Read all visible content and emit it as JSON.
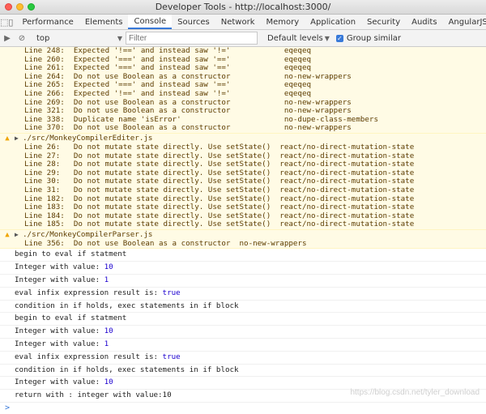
{
  "window": {
    "title": "Developer Tools - http://localhost:3000/"
  },
  "tabs": [
    "Performance",
    "Elements",
    "Console",
    "Sources",
    "Network",
    "Memory",
    "Application",
    "Security",
    "Audits",
    "AngularJS"
  ],
  "active_tab": "Console",
  "toolbar": {
    "context": "top",
    "filter_placeholder": "Filter",
    "levels": "Default levels",
    "group_similar": "Group similar"
  },
  "warnings_block1": [
    "Line 248:  Expected '!==' and instead saw '!='            eqeqeq",
    "Line 260:  Expected '===' and instead saw '=='            eqeqeq",
    "Line 261:  Expected '===' and instead saw '=='            eqeqeq",
    "Line 264:  Do not use Boolean as a constructor            no-new-wrappers",
    "Line 265:  Expected '===' and instead saw '=='            eqeqeq",
    "Line 266:  Expected '!==' and instead saw '!='            eqeqeq",
    "Line 269:  Do not use Boolean as a constructor            no-new-wrappers",
    "Line 321:  Do not use Boolean as a constructor            no-new-wrappers",
    "Line 338:  Duplicate name 'isError'                       no-dupe-class-members",
    "Line 370:  Do not use Boolean as a constructor            no-new-wrappers"
  ],
  "group2": {
    "header": "./src/MonkeyCompilerEditer.js",
    "lines": [
      "Line 26:   Do not mutate state directly. Use setState()  react/no-direct-mutation-state",
      "Line 27:   Do not mutate state directly. Use setState()  react/no-direct-mutation-state",
      "Line 28:   Do not mutate state directly. Use setState()  react/no-direct-mutation-state",
      "Line 29:   Do not mutate state directly. Use setState()  react/no-direct-mutation-state",
      "Line 30:   Do not mutate state directly. Use setState()  react/no-direct-mutation-state",
      "Line 31:   Do not mutate state directly. Use setState()  react/no-direct-mutation-state",
      "Line 182:  Do not mutate state directly. Use setState()  react/no-direct-mutation-state",
      "Line 183:  Do not mutate state directly. Use setState()  react/no-direct-mutation-state",
      "Line 184:  Do not mutate state directly. Use setState()  react/no-direct-mutation-state",
      "Line 185:  Do not mutate state directly. Use setState()  react/no-direct-mutation-state"
    ]
  },
  "group3": {
    "header": "./src/MonkeyCompilerParser.js",
    "lines": [
      "Line 356:  Do not use Boolean as a constructor  no-new-wrappers"
    ]
  },
  "logs": [
    {
      "text": "begin to eval if statment",
      "value": ""
    },
    {
      "text": "Integer with value: ",
      "value": "10"
    },
    {
      "text": "Integer with value: ",
      "value": "1"
    },
    {
      "text": "eval infix expression result is: ",
      "value": "true"
    },
    {
      "text": "condition in if holds, exec statements in if block",
      "value": ""
    },
    {
      "text": "begin to eval if statment",
      "value": ""
    },
    {
      "text": "Integer with value: ",
      "value": "10"
    },
    {
      "text": "Integer with value: ",
      "value": "1"
    },
    {
      "text": "eval infix expression result is: ",
      "value": "true"
    },
    {
      "text": "condition in if holds, exec statements in if block",
      "value": ""
    },
    {
      "text": "Integer with value: ",
      "value": "10"
    },
    {
      "text": "return with : integer with value:10",
      "value": ""
    }
  ],
  "prompt_symbol": ">",
  "watermark": "https://blog.csdn.net/tyler_download",
  "colors": {
    "accent": "#3879d9",
    "warning_bg": "#fffbe5",
    "warning_text": "#5c3c00",
    "number": "#1c00cf"
  }
}
